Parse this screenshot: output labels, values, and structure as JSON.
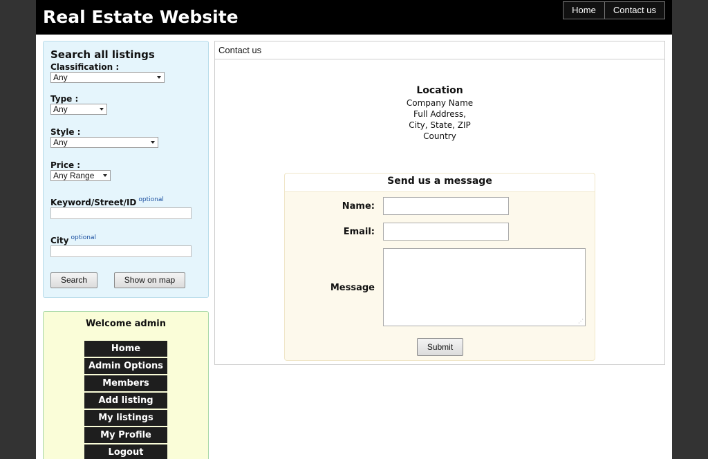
{
  "header": {
    "title": "Real Estate Website",
    "nav": {
      "home": "Home",
      "contact": "Contact us"
    }
  },
  "search": {
    "title": "Search all listings",
    "classification_label": "Classification :",
    "classification_value": "Any",
    "type_label": "Type :",
    "type_value": "Any",
    "style_label": "Style :",
    "style_value": "Any",
    "price_label": "Price :",
    "price_value": "Any Range",
    "keyword_label": "Keyword/Street/ID",
    "city_label": "City",
    "optional_tag": "optional",
    "search_button": "Search",
    "map_button": "Show on map"
  },
  "welcome": {
    "title": "Welcome admin",
    "menu": [
      "Home",
      "Admin Options",
      "Members",
      "Add listing",
      "My listings",
      "My Profile",
      "Logout"
    ]
  },
  "content": {
    "breadcrumb": "Contact us",
    "location": {
      "title": "Location",
      "company": "Company Name",
      "address": "Full Address,",
      "city_line": "City, State, ZIP",
      "country": "Country"
    },
    "form": {
      "title": "Send us a message",
      "name_label": "Name:",
      "email_label": "Email:",
      "message_label": "Message",
      "submit": "Submit"
    }
  },
  "colors": {
    "background": "#333333",
    "header": "#000000",
    "search_panel": "#e5f5fc",
    "welcome_panel": "#fafdd8",
    "menu_item": "#1e1e1e",
    "form_panel": "#fdf9ec",
    "optional_tag": "#1a4fa0"
  }
}
